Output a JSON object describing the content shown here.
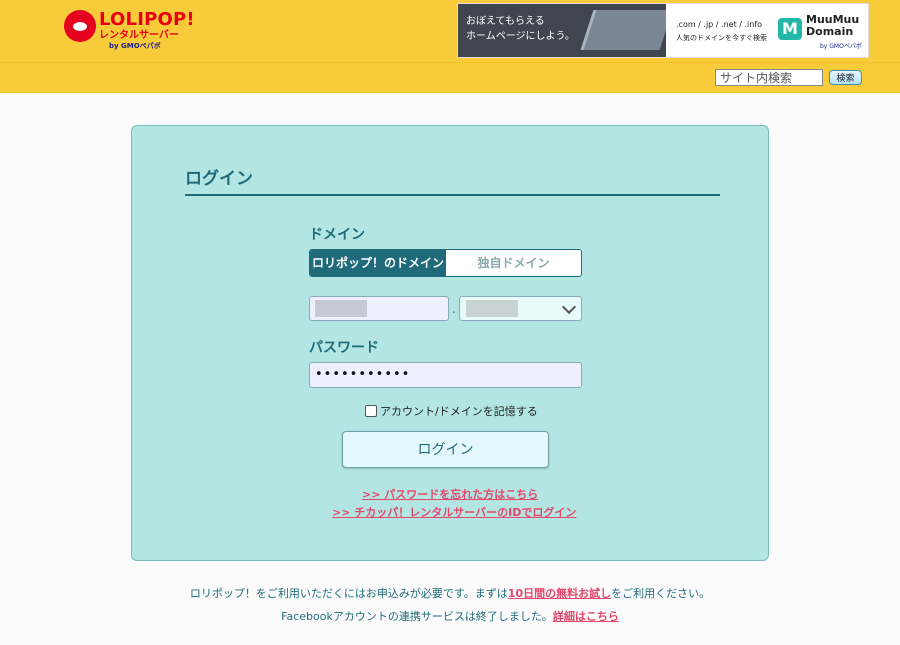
{
  "header": {
    "logo_main": "LOLIPOP!",
    "logo_sub": "レンタルサーバー",
    "logo_by": "by GMOペパボ",
    "banner": {
      "left_line1": "おぼえてもらえる",
      "left_line2": "ホームページにしよう。",
      "tlds": ".com / .jp / .net / .info",
      "desc": "人気のドメインを今すぐ検索",
      "brand": "MuuMuu Domain",
      "brand_by": "by GMOペパボ"
    },
    "search": {
      "placeholder": "サイト内検索",
      "button_label": "検索"
    }
  },
  "login": {
    "title": "ログイン",
    "domain_label": "ドメイン",
    "tabs": [
      {
        "label": "ロリポップ！のドメイン"
      },
      {
        "label": "独自ドメイン"
      }
    ],
    "domain_separator": ".",
    "password_label": "パスワード",
    "password_value": "•••••••••••",
    "remember_label": "アカウント/ドメインを記憶する",
    "submit_label": "ログイン",
    "forgot_link": ">> パスワードを忘れた方はこちら",
    "chicappa_link": ">> チカッパ！レンタルサーバーのIDでログイン"
  },
  "footer": {
    "line1_prefix": "ロリポップ！をご利用いただくにはお申込みが必要です。まずは",
    "line1_link": "10日間の無料お試し",
    "line1_suffix": "をご利用ください。",
    "line2_prefix": "Facebookアカウントの連携サービスは終了しました。",
    "line2_link": "詳細はこちら"
  }
}
